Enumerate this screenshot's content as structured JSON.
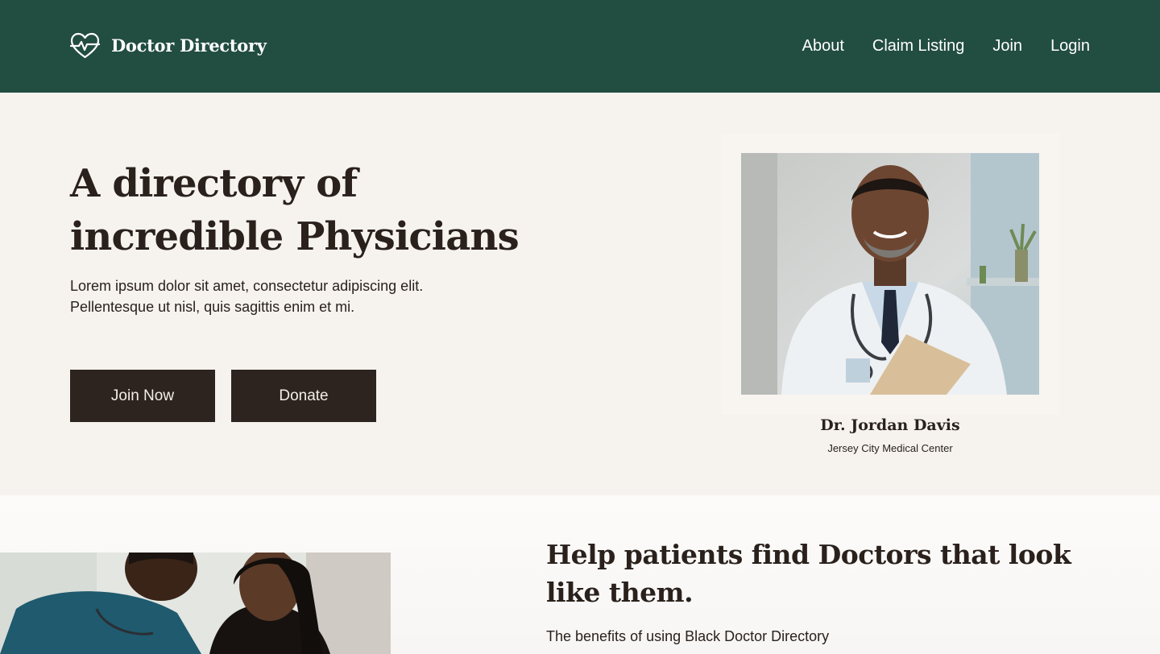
{
  "header": {
    "brand": "Doctor Directory",
    "nav": [
      "About",
      "Claim Listing",
      "Join",
      "Login"
    ]
  },
  "hero": {
    "title": "A directory of incredible Physicians",
    "subtitle": "Lorem ipsum dolor sit amet, consectetur adipiscing elit. Pellentesque ut nisl, quis sagittis enim et mi.",
    "buttons": {
      "join": "Join Now",
      "donate": "Donate"
    },
    "featured": {
      "name": "Dr. Jordan Davis",
      "place": "Jersey City Medical Center"
    }
  },
  "section": {
    "title": "Help patients find Doctors that look like them.",
    "subtitle": "The benefits of using Black Doctor Directory"
  },
  "colors": {
    "header": "#224d41",
    "button": "#2e241f",
    "background": "#f6f3ef"
  },
  "icons": {
    "logo": "heart-pulse-icon"
  }
}
